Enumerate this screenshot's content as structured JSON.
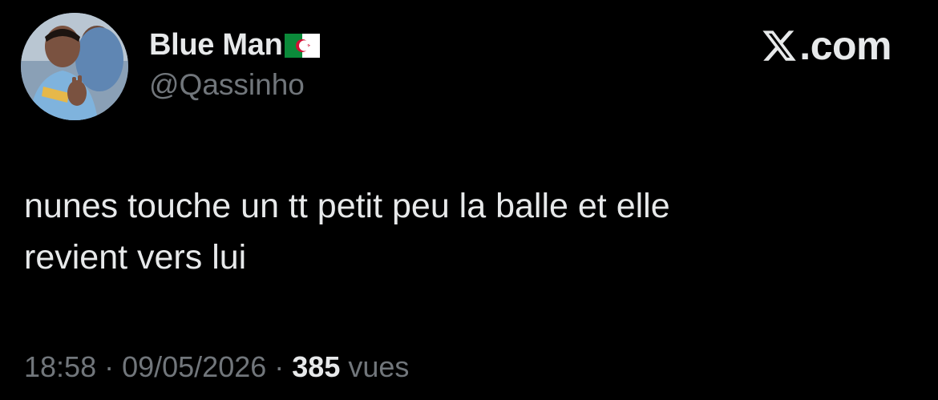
{
  "author": {
    "display_name": "Blue Man",
    "flag": "algeria-flag-icon",
    "handle": "@Qassinho"
  },
  "brand": {
    "icon": "x-logo-icon",
    "suffix": ".com"
  },
  "tweet": {
    "text": "nunes touche un tt petit peu la balle et elle\nrevient vers lui"
  },
  "meta": {
    "time": "18:58",
    "separator": " · ",
    "date": "09/05/2026",
    "views_count": "385",
    "views_label": " vues"
  },
  "colors": {
    "background": "#000000",
    "primary_text": "#e7e9ea",
    "secondary_text": "#71767b"
  }
}
